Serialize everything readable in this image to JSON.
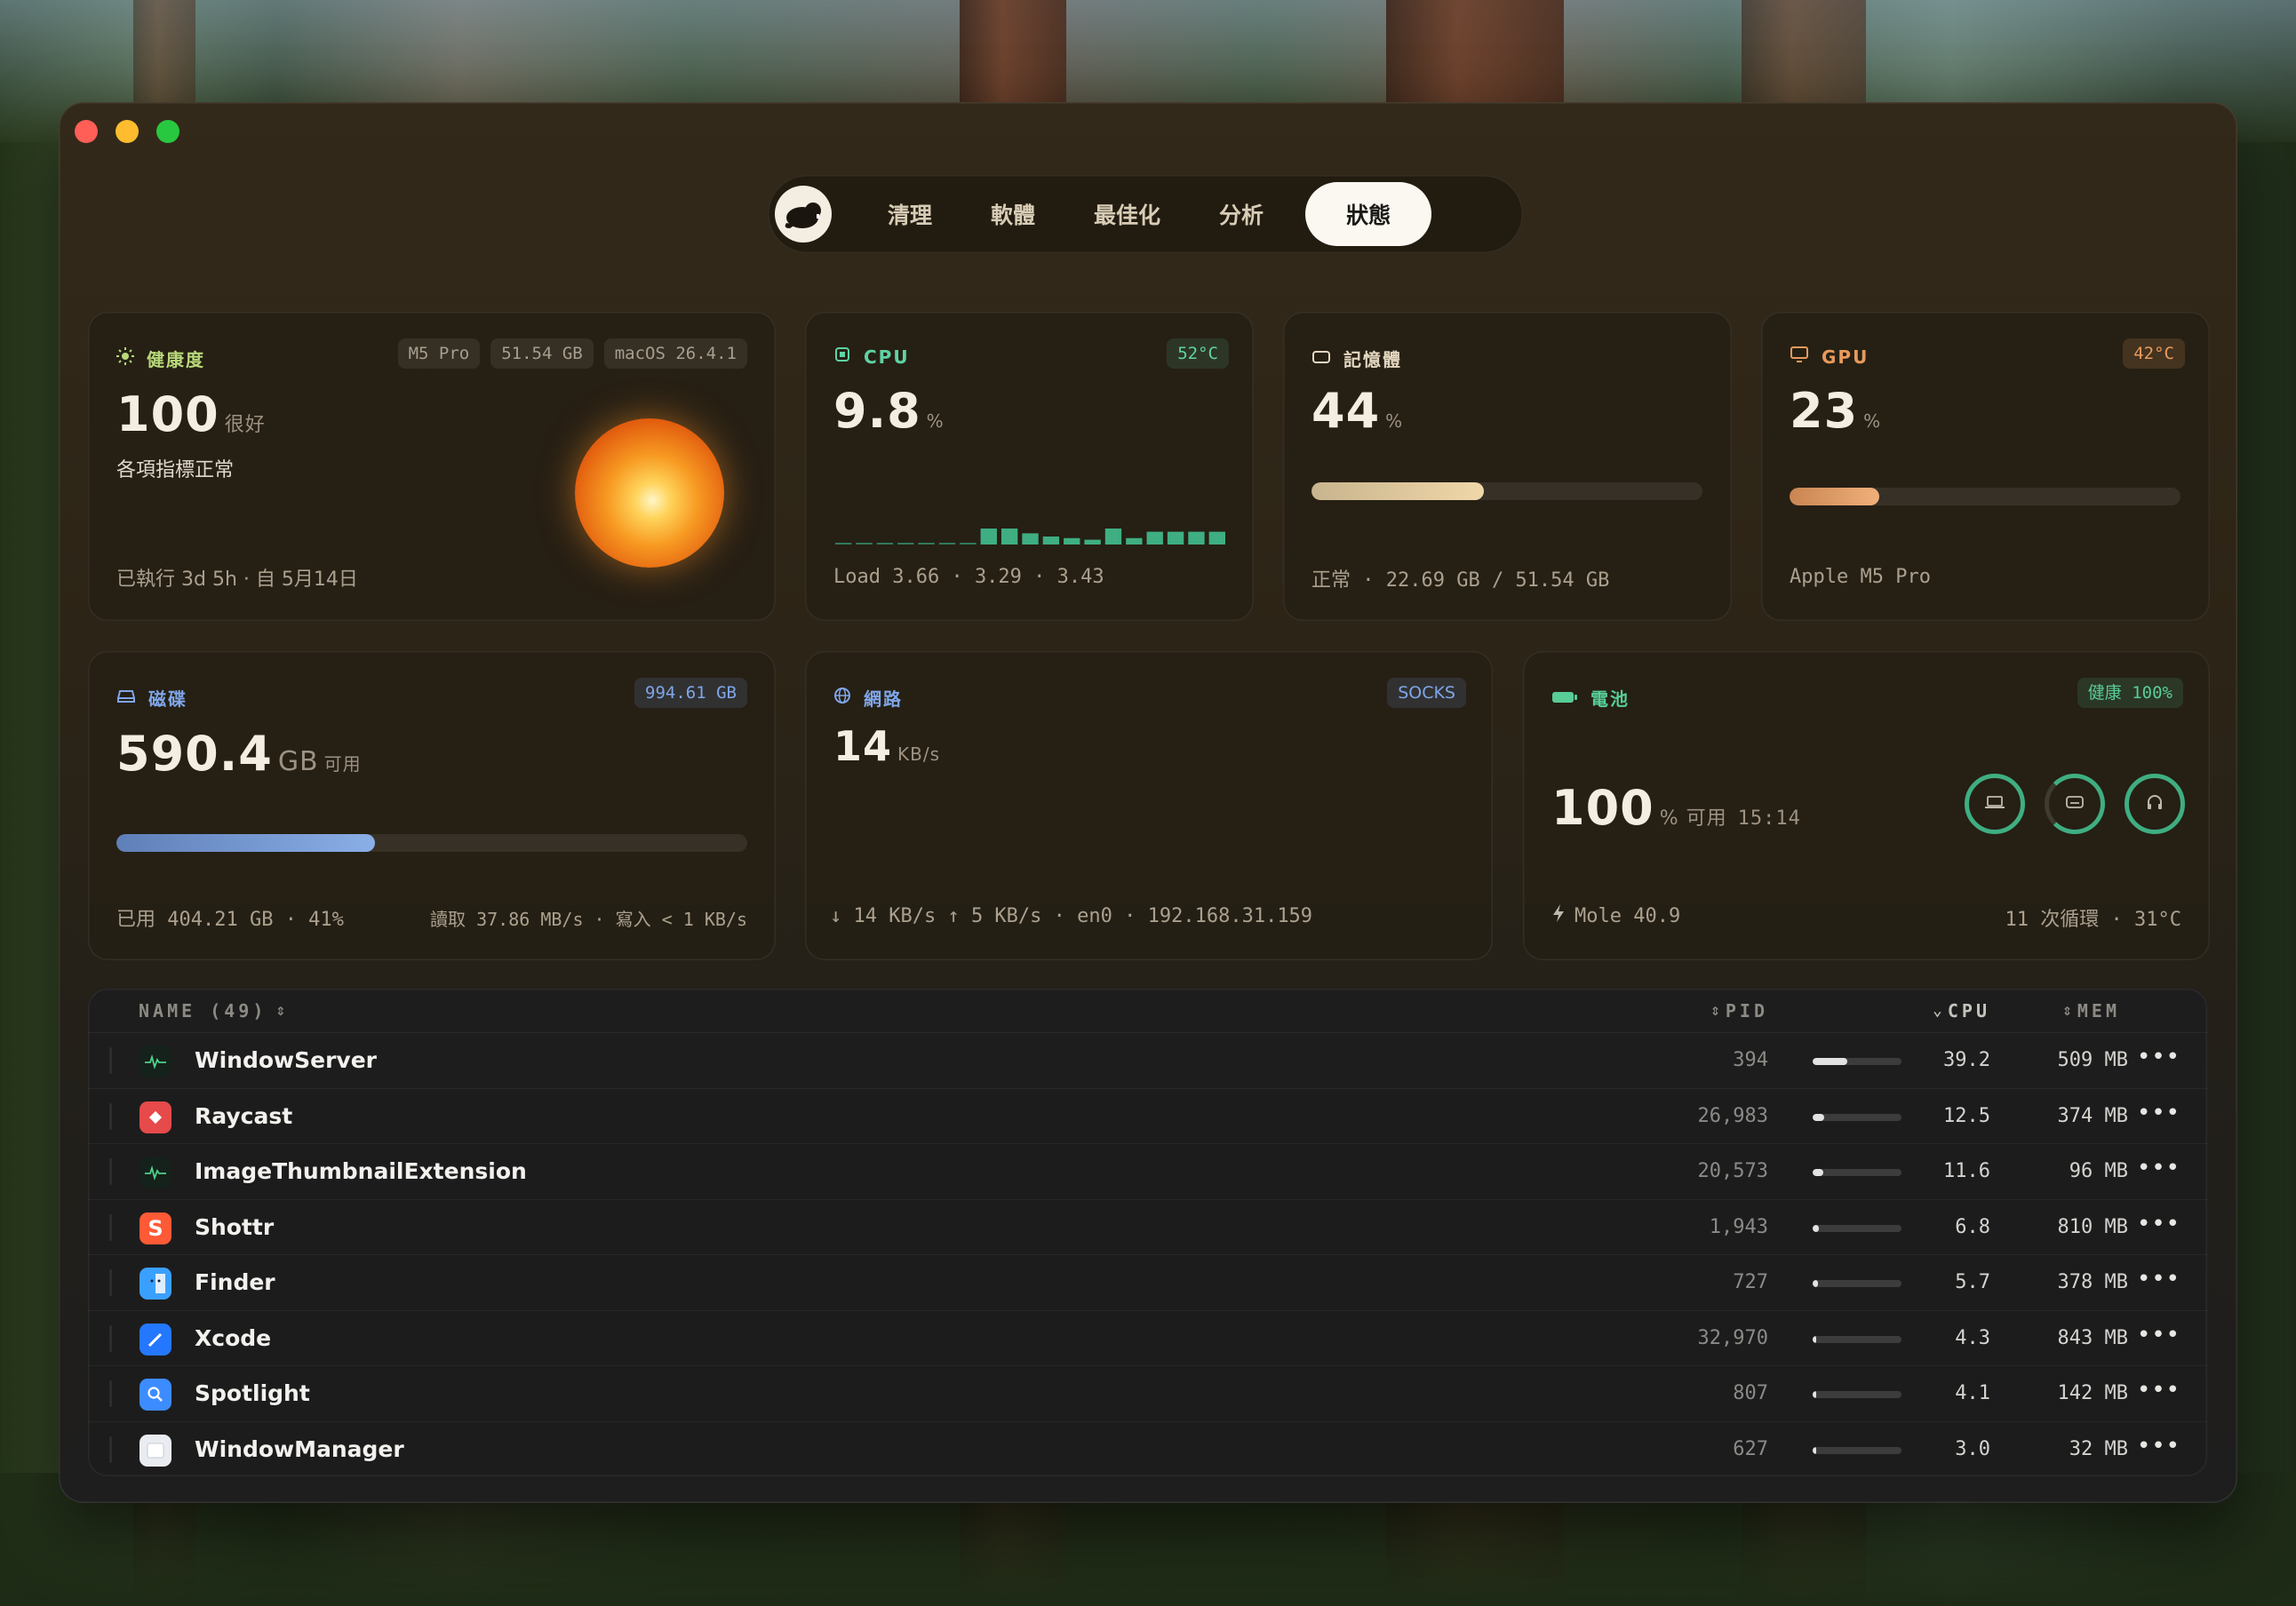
{
  "nav": {
    "tabs": [
      "清理",
      "軟體",
      "最佳化",
      "分析"
    ],
    "active_tab": "狀態"
  },
  "health": {
    "title": "健康度",
    "chips": [
      "M5 Pro",
      "51.54 GB",
      "macOS 26.4.1"
    ],
    "score": "100",
    "grade": "很好",
    "status": "各項指標正常",
    "uptime": "已執行 3d 5h · 自 5月14日"
  },
  "cpu": {
    "title": "CPU",
    "temp": "52°C",
    "value": "9.8",
    "unit": "%",
    "load": "Load 3.66 · 3.29 · 3.43",
    "history": [
      0,
      0,
      0,
      0,
      0,
      0,
      0,
      1,
      1,
      0.7,
      0.5,
      0.4,
      0.3,
      1,
      0.4,
      0.8,
      0.8,
      0.8,
      0.8
    ]
  },
  "memory": {
    "title": "記憶體",
    "value": "44",
    "unit": "%",
    "usage": 0.44,
    "detail": "正常 · 22.69 GB / 51.54 GB"
  },
  "gpu": {
    "title": "GPU",
    "temp": "42°C",
    "value": "23",
    "unit": "%",
    "usage": 0.23,
    "model": "Apple M5 Pro"
  },
  "disk": {
    "title": "磁碟",
    "total": "994.61 GB",
    "free": "590.4",
    "free_unit": "GB",
    "free_label": "可用",
    "usage": 0.41,
    "used": "已用 404.21 GB · 41%",
    "io": "讀取 37.86 MB/s · 寫入 < 1 KB/s"
  },
  "network": {
    "title": "網路",
    "badge": "SOCKS",
    "value": "14",
    "unit": "KB/s",
    "detail": "↓ 14 KB/s  ↑ 5 KB/s · en0 · 192.168.31.159"
  },
  "battery": {
    "title": "電池",
    "health": "健康 100%",
    "value": "100",
    "unit": "% 可用",
    "time": "15:14",
    "source": "Mole 40.9",
    "cycles": "11 次循環 · 31°C"
  },
  "processes": {
    "headers": {
      "name": "NAME (49)",
      "pid": "PID",
      "cpu": "CPU",
      "mem": "MEM"
    },
    "rows": [
      {
        "name": "WindowServer",
        "pid": "394",
        "cpu": "39.2",
        "mem": "509 MB",
        "icon": "activity-icon",
        "cpu_frac": 0.392
      },
      {
        "name": "Raycast",
        "pid": "26,983",
        "cpu": "12.5",
        "mem": "374 MB",
        "icon": "raycast-icon",
        "cpu_frac": 0.125
      },
      {
        "name": "ImageThumbnailExtension",
        "pid": "20,573",
        "cpu": "11.6",
        "mem": "96 MB",
        "icon": "activity-icon",
        "cpu_frac": 0.116
      },
      {
        "name": "Shottr",
        "pid": "1,943",
        "cpu": "6.8",
        "mem": "810 MB",
        "icon": "shottr-icon",
        "cpu_frac": 0.068
      },
      {
        "name": "Finder",
        "pid": "727",
        "cpu": "5.7",
        "mem": "378 MB",
        "icon": "finder-icon",
        "cpu_frac": 0.057
      },
      {
        "name": "Xcode",
        "pid": "32,970",
        "cpu": "4.3",
        "mem": "843 MB",
        "icon": "xcode-icon",
        "cpu_frac": 0.043
      },
      {
        "name": "Spotlight",
        "pid": "807",
        "cpu": "4.1",
        "mem": "142 MB",
        "icon": "spotlight-icon",
        "cpu_frac": 0.041
      },
      {
        "name": "WindowManager",
        "pid": "627",
        "cpu": "3.0",
        "mem": "32 MB",
        "icon": "window-manager-icon",
        "cpu_frac": 0.03
      }
    ]
  }
}
